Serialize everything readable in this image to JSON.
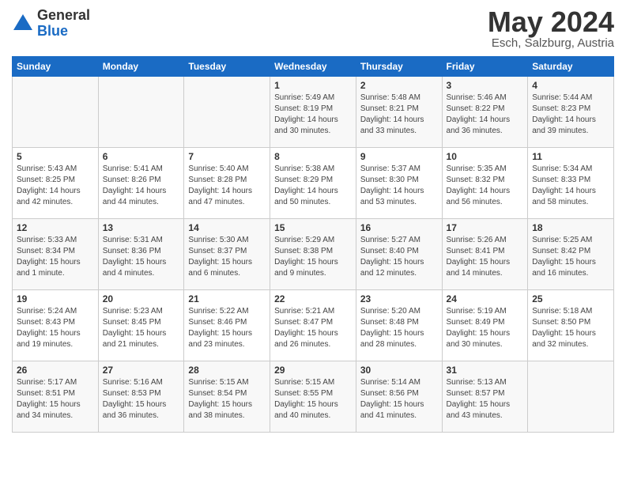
{
  "logo": {
    "general": "General",
    "blue": "Blue"
  },
  "header": {
    "month_title": "May 2024",
    "subtitle": "Esch, Salzburg, Austria"
  },
  "days_of_week": [
    "Sunday",
    "Monday",
    "Tuesday",
    "Wednesday",
    "Thursday",
    "Friday",
    "Saturday"
  ],
  "weeks": [
    [
      {
        "day": "",
        "info": ""
      },
      {
        "day": "",
        "info": ""
      },
      {
        "day": "",
        "info": ""
      },
      {
        "day": "1",
        "info": "Sunrise: 5:49 AM\nSunset: 8:19 PM\nDaylight: 14 hours\nand 30 minutes."
      },
      {
        "day": "2",
        "info": "Sunrise: 5:48 AM\nSunset: 8:21 PM\nDaylight: 14 hours\nand 33 minutes."
      },
      {
        "day": "3",
        "info": "Sunrise: 5:46 AM\nSunset: 8:22 PM\nDaylight: 14 hours\nand 36 minutes."
      },
      {
        "day": "4",
        "info": "Sunrise: 5:44 AM\nSunset: 8:23 PM\nDaylight: 14 hours\nand 39 minutes."
      }
    ],
    [
      {
        "day": "5",
        "info": "Sunrise: 5:43 AM\nSunset: 8:25 PM\nDaylight: 14 hours\nand 42 minutes."
      },
      {
        "day": "6",
        "info": "Sunrise: 5:41 AM\nSunset: 8:26 PM\nDaylight: 14 hours\nand 44 minutes."
      },
      {
        "day": "7",
        "info": "Sunrise: 5:40 AM\nSunset: 8:28 PM\nDaylight: 14 hours\nand 47 minutes."
      },
      {
        "day": "8",
        "info": "Sunrise: 5:38 AM\nSunset: 8:29 PM\nDaylight: 14 hours\nand 50 minutes."
      },
      {
        "day": "9",
        "info": "Sunrise: 5:37 AM\nSunset: 8:30 PM\nDaylight: 14 hours\nand 53 minutes."
      },
      {
        "day": "10",
        "info": "Sunrise: 5:35 AM\nSunset: 8:32 PM\nDaylight: 14 hours\nand 56 minutes."
      },
      {
        "day": "11",
        "info": "Sunrise: 5:34 AM\nSunset: 8:33 PM\nDaylight: 14 hours\nand 58 minutes."
      }
    ],
    [
      {
        "day": "12",
        "info": "Sunrise: 5:33 AM\nSunset: 8:34 PM\nDaylight: 15 hours\nand 1 minute."
      },
      {
        "day": "13",
        "info": "Sunrise: 5:31 AM\nSunset: 8:36 PM\nDaylight: 15 hours\nand 4 minutes."
      },
      {
        "day": "14",
        "info": "Sunrise: 5:30 AM\nSunset: 8:37 PM\nDaylight: 15 hours\nand 6 minutes."
      },
      {
        "day": "15",
        "info": "Sunrise: 5:29 AM\nSunset: 8:38 PM\nDaylight: 15 hours\nand 9 minutes."
      },
      {
        "day": "16",
        "info": "Sunrise: 5:27 AM\nSunset: 8:40 PM\nDaylight: 15 hours\nand 12 minutes."
      },
      {
        "day": "17",
        "info": "Sunrise: 5:26 AM\nSunset: 8:41 PM\nDaylight: 15 hours\nand 14 minutes."
      },
      {
        "day": "18",
        "info": "Sunrise: 5:25 AM\nSunset: 8:42 PM\nDaylight: 15 hours\nand 16 minutes."
      }
    ],
    [
      {
        "day": "19",
        "info": "Sunrise: 5:24 AM\nSunset: 8:43 PM\nDaylight: 15 hours\nand 19 minutes."
      },
      {
        "day": "20",
        "info": "Sunrise: 5:23 AM\nSunset: 8:45 PM\nDaylight: 15 hours\nand 21 minutes."
      },
      {
        "day": "21",
        "info": "Sunrise: 5:22 AM\nSunset: 8:46 PM\nDaylight: 15 hours\nand 23 minutes."
      },
      {
        "day": "22",
        "info": "Sunrise: 5:21 AM\nSunset: 8:47 PM\nDaylight: 15 hours\nand 26 minutes."
      },
      {
        "day": "23",
        "info": "Sunrise: 5:20 AM\nSunset: 8:48 PM\nDaylight: 15 hours\nand 28 minutes."
      },
      {
        "day": "24",
        "info": "Sunrise: 5:19 AM\nSunset: 8:49 PM\nDaylight: 15 hours\nand 30 minutes."
      },
      {
        "day": "25",
        "info": "Sunrise: 5:18 AM\nSunset: 8:50 PM\nDaylight: 15 hours\nand 32 minutes."
      }
    ],
    [
      {
        "day": "26",
        "info": "Sunrise: 5:17 AM\nSunset: 8:51 PM\nDaylight: 15 hours\nand 34 minutes."
      },
      {
        "day": "27",
        "info": "Sunrise: 5:16 AM\nSunset: 8:53 PM\nDaylight: 15 hours\nand 36 minutes."
      },
      {
        "day": "28",
        "info": "Sunrise: 5:15 AM\nSunset: 8:54 PM\nDaylight: 15 hours\nand 38 minutes."
      },
      {
        "day": "29",
        "info": "Sunrise: 5:15 AM\nSunset: 8:55 PM\nDaylight: 15 hours\nand 40 minutes."
      },
      {
        "day": "30",
        "info": "Sunrise: 5:14 AM\nSunset: 8:56 PM\nDaylight: 15 hours\nand 41 minutes."
      },
      {
        "day": "31",
        "info": "Sunrise: 5:13 AM\nSunset: 8:57 PM\nDaylight: 15 hours\nand 43 minutes."
      },
      {
        "day": "",
        "info": ""
      }
    ]
  ]
}
